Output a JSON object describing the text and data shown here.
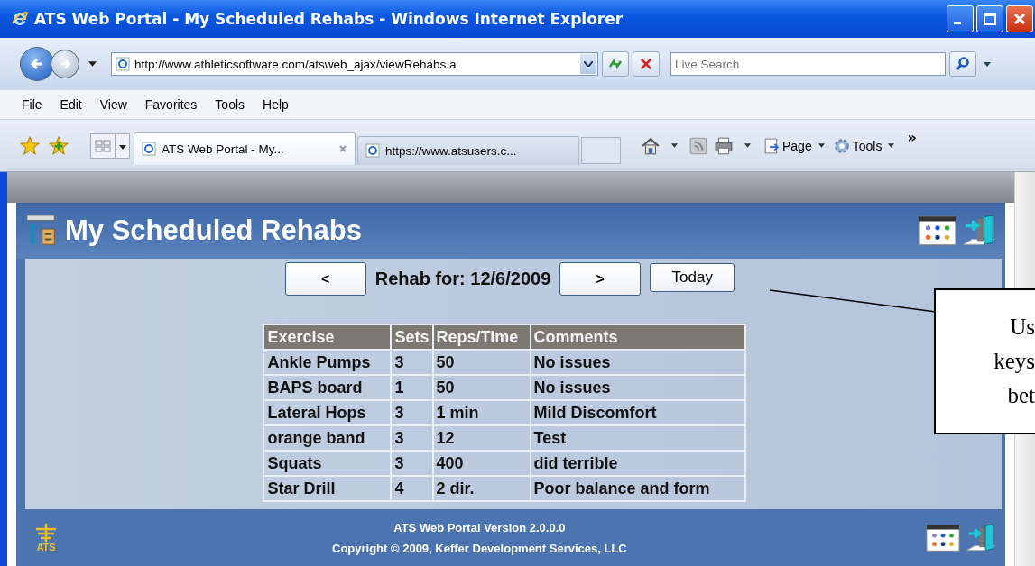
{
  "window": {
    "title": "ATS Web Portal - My Scheduled Rehabs - Windows Internet Explorer"
  },
  "address_bar": {
    "url": "http://www.athleticsoftware.com/atsweb_ajax/viewRehabs.a"
  },
  "search": {
    "placeholder": "Live Search"
  },
  "menu": [
    "File",
    "Edit",
    "View",
    "Favorites",
    "Tools",
    "Help"
  ],
  "tabs": [
    {
      "label": "ATS Web Portal - My...",
      "selected": true
    },
    {
      "label": "https://www.atsusers.c...",
      "selected": false
    }
  ],
  "command_bar": {
    "items": [
      "Page",
      "Tools"
    ],
    "overflow": "»"
  },
  "page": {
    "title": "My Scheduled Rehabs",
    "prev": "<",
    "date_label": "Rehab for: 12/6/2009",
    "next": ">",
    "today": "Today"
  },
  "table": {
    "columns": [
      "Exercise",
      "Sets",
      "Reps/Time",
      "Comments"
    ],
    "rows": [
      [
        "Ankle Pumps",
        "3",
        "50",
        "No issues"
      ],
      [
        "BAPS board",
        "1",
        "50",
        "No issues"
      ],
      [
        "Lateral Hops",
        "3",
        "1 min",
        "Mild Discomfort"
      ],
      [
        "orange band",
        "3",
        "12",
        "Test"
      ],
      [
        "Squats",
        "3",
        "400",
        "did terrible"
      ],
      [
        "Star Drill",
        "4",
        "2 dir.",
        "Poor balance and form"
      ]
    ]
  },
  "footer": {
    "logo": "ATS",
    "version": "ATS Web Portal Version 2.0.0.0",
    "copyright": "Copyright © 2009, Keffer Development Services, LLC"
  },
  "callout": {
    "lines": [
      "Us",
      "keys",
      "bet"
    ]
  }
}
